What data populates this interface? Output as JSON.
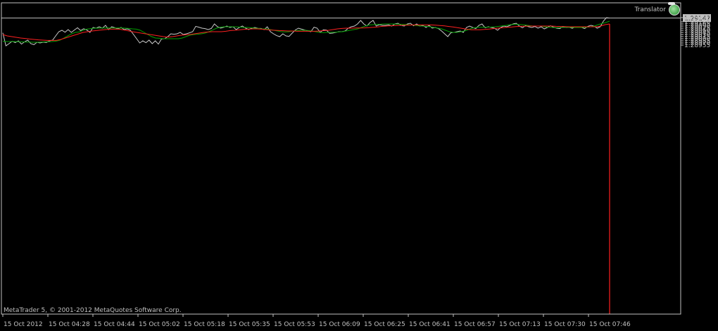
{
  "app": {
    "indicator_name": "Translator",
    "copyright": "MetaTrader 5, © 2001-2012 MetaQuotes Software Corp."
  },
  "chart_data": {
    "type": "line",
    "current_price": "1.29147",
    "ylim": [
      1.2893,
      1.2916
    ],
    "y_ticks": [
      "1.29150",
      "1.29120",
      "1.29105",
      "1.29090",
      "1.29075",
      "1.29060",
      "1.29045",
      "1.29030",
      "1.29015",
      "1.29000",
      "1.28985",
      "1.28970",
      "1.28955"
    ],
    "x_ticks": [
      "15 Oct 2012",
      "15 Oct 04:28",
      "15 Oct 04:44",
      "15 Oct 05:02",
      "15 Oct 05:18",
      "15 Oct 05:35",
      "15 Oct 05:53",
      "15 Oct 06:09",
      "15 Oct 06:25",
      "15 Oct 06:41",
      "15 Oct 06:57",
      "15 Oct 07:13",
      "15 Oct 07:30",
      "15 Oct 07:46"
    ],
    "colors": {
      "price": "#c8c8c8",
      "fast": "#00a000",
      "slow": "#ff2020",
      "grid": "#c0c0c0"
    },
    "series": [
      {
        "key": "price",
        "values": [
          1.29042,
          1.2895,
          1.28965,
          1.28982,
          1.28972,
          1.28985,
          1.28962,
          1.28978,
          1.2899,
          1.28965,
          1.28958,
          1.28975,
          1.2897,
          1.28976,
          1.28973,
          1.28985,
          1.2899,
          1.2902,
          1.2905,
          1.2906,
          1.29046,
          1.29065,
          1.29045,
          1.29062,
          1.29078,
          1.29058,
          1.29071,
          1.29062,
          1.29045,
          1.2908,
          1.29075,
          1.29085,
          1.29075,
          1.29095,
          1.29065,
          1.29085,
          1.29078,
          1.2907,
          1.2908,
          1.29065,
          1.2907,
          1.2906,
          1.2903,
          1.29,
          1.2897,
          1.28985,
          1.28972,
          1.2899,
          1.28965,
          1.28985,
          1.28962,
          1.28998,
          1.29,
          1.29015,
          1.29035,
          1.29032,
          1.29035,
          1.29045,
          1.2903,
          1.29035,
          1.29042,
          1.2905,
          1.29088,
          1.29082,
          1.29075,
          1.29072,
          1.29065,
          1.29073,
          1.29105,
          1.29085,
          1.29075,
          1.29082,
          1.2909,
          1.2908,
          1.29085,
          1.29065,
          1.2908,
          1.2909,
          1.29075,
          1.29065,
          1.29075,
          1.2908,
          1.29074,
          1.29073,
          1.29065,
          1.29085,
          1.2905,
          1.29035,
          1.29022,
          1.29015,
          1.29035,
          1.2902,
          1.29017,
          1.2904,
          1.29062,
          1.29075,
          1.29068,
          1.29062,
          1.29055,
          1.2905,
          1.29082,
          1.29075,
          1.29045,
          1.29063,
          1.29062,
          1.29038,
          1.2904,
          1.29045,
          1.2905,
          1.2905,
          1.29055,
          1.29075,
          1.29085,
          1.2909,
          1.29105,
          1.2913,
          1.29105,
          1.2909,
          1.29115,
          1.2913,
          1.2909,
          1.291,
          1.29095,
          1.29095,
          1.29098,
          1.2909,
          1.29105,
          1.2911,
          1.29095,
          1.2909,
          1.29105,
          1.2911,
          1.29092,
          1.29105,
          1.2909,
          1.29095,
          1.2908,
          1.29095,
          1.29075,
          1.2908,
          1.29072,
          1.29055,
          1.29035,
          1.29015,
          1.29043,
          1.29045,
          1.2905,
          1.29055,
          1.29045,
          1.2908,
          1.2909,
          1.2908,
          1.29072,
          1.29095,
          1.29105,
          1.29078,
          1.29085,
          1.2908,
          1.29075,
          1.2906,
          1.2908,
          1.2909,
          1.29085,
          1.29095,
          1.29105,
          1.2911,
          1.2909,
          1.29078,
          1.29093,
          1.29085,
          1.2908,
          1.29087,
          1.29075,
          1.29085,
          1.2907,
          1.2908,
          1.29092,
          1.29082,
          1.29075,
          1.29072,
          1.29087,
          1.2908,
          1.29082,
          1.29074,
          1.29085,
          1.2908,
          1.2908,
          1.29072,
          1.29088,
          1.29095,
          1.2909,
          1.29075,
          1.29085,
          1.29125,
          1.2915,
          1.29147
        ]
      },
      {
        "key": "fast",
        "values": [
          1.28982,
          1.2898,
          1.2898,
          1.2898,
          1.28979,
          1.28978,
          1.28976,
          1.28976,
          1.28975,
          1.28975,
          1.28976,
          1.28978,
          1.28979,
          1.2898,
          1.28983,
          1.2899,
          1.29005,
          1.2902,
          1.29035,
          1.29045,
          1.29048,
          1.2906,
          1.29068,
          1.29072,
          1.29075,
          1.29075,
          1.29076,
          1.29077,
          1.29076,
          1.29076,
          1.29076,
          1.29077,
          1.29075,
          1.29073,
          1.2907,
          1.29068,
          1.2906,
          1.29045,
          1.2903,
          1.29015,
          1.29005,
          1.29003,
          1.29,
          1.29,
          1.29,
          1.29,
          1.29,
          1.29005,
          1.29015,
          1.29025,
          1.2903,
          1.29032,
          1.29035,
          1.2904,
          1.2905,
          1.29062,
          1.29075,
          1.29082,
          1.29085,
          1.29085,
          1.29085,
          1.29085,
          1.29083,
          1.2908,
          1.2908,
          1.29078,
          1.29075,
          1.29073,
          1.2907,
          1.2907,
          1.29065,
          1.2906,
          1.29055,
          1.2905,
          1.29048,
          1.2905,
          1.29055,
          1.29058,
          1.2906,
          1.2906,
          1.29058,
          1.29055,
          1.2905,
          1.29045,
          1.29043,
          1.29045,
          1.29045,
          1.29046,
          1.29048,
          1.2905,
          1.29055,
          1.2906,
          1.29065,
          1.2907,
          1.2908,
          1.2909,
          1.29098,
          1.291,
          1.29102,
          1.29103,
          1.29105,
          1.29105,
          1.29105,
          1.29104,
          1.29103,
          1.29102,
          1.291,
          1.29098,
          1.29095,
          1.29092,
          1.2909,
          1.29088,
          1.29085,
          1.2908,
          1.29075,
          1.2907,
          1.2906,
          1.2905,
          1.29045,
          1.29045,
          1.2905,
          1.29055,
          1.29065,
          1.29075,
          1.2908,
          1.29082,
          1.29082,
          1.29082,
          1.29083,
          1.29085,
          1.29088,
          1.29092,
          1.29095,
          1.291,
          1.29102,
          1.29102,
          1.291,
          1.29097,
          1.29093,
          1.2909,
          1.2909,
          1.2909,
          1.29085,
          1.29082,
          1.2908,
          1.29078,
          1.2908,
          1.2908,
          1.29082,
          1.2908,
          1.2908,
          1.2908,
          1.2908,
          1.29082,
          1.29085,
          1.2909,
          1.291,
          1.29108,
          1.29115,
          1.29125
        ]
      },
      {
        "key": "slow",
        "values": [
          1.2903,
          1.2902,
          1.29015,
          1.2901,
          1.29005,
          1.29002,
          1.28998,
          1.28995,
          1.28992,
          1.2899,
          1.28988,
          1.28988,
          1.28988,
          1.28995,
          1.29005,
          1.29015,
          1.29025,
          1.29035,
          1.29045,
          1.2905,
          1.29055,
          1.29058,
          1.29062,
          1.29065,
          1.29068,
          1.29068,
          1.29068,
          1.29063,
          1.29057,
          1.2905,
          1.29045,
          1.2904,
          1.29035,
          1.2903,
          1.29025,
          1.2902,
          1.29015,
          1.29012,
          1.29015,
          1.2902,
          1.29025,
          1.29028,
          1.2903,
          1.29035,
          1.2904,
          1.29045,
          1.29048,
          1.2905,
          1.2905,
          1.2905,
          1.29053,
          1.29058,
          1.2906,
          1.29063,
          1.29066,
          1.29068,
          1.2907,
          1.2907,
          1.29068,
          1.29065,
          1.29062,
          1.2906,
          1.29058,
          1.29057,
          1.29055,
          1.29055,
          1.29053,
          1.29053,
          1.29053,
          1.29053,
          1.29053,
          1.29055,
          1.29058,
          1.2906,
          1.29065,
          1.2907,
          1.29073,
          1.29075,
          1.29075,
          1.29076,
          1.29076,
          1.29077,
          1.29079,
          1.29081,
          1.29084,
          1.29088,
          1.2909,
          1.29092,
          1.29094,
          1.29095,
          1.29096,
          1.29097,
          1.29098,
          1.29098,
          1.29098,
          1.29098,
          1.29098,
          1.29096,
          1.29094,
          1.29091,
          1.29087,
          1.29083,
          1.29078,
          1.29073,
          1.29068,
          1.29064,
          1.29064,
          1.29064,
          1.29066,
          1.29069,
          1.29072,
          1.29075,
          1.29078,
          1.29081,
          1.29083,
          1.29086,
          1.29088,
          1.29089,
          1.2909,
          1.2909,
          1.2909,
          1.2909,
          1.2909,
          1.2909,
          1.29088,
          1.29087,
          1.29086,
          1.29085,
          1.29085,
          1.29085,
          1.29085,
          1.29085,
          1.29085,
          1.29085,
          1.2909,
          1.291,
          1.29105
        ]
      }
    ]
  }
}
